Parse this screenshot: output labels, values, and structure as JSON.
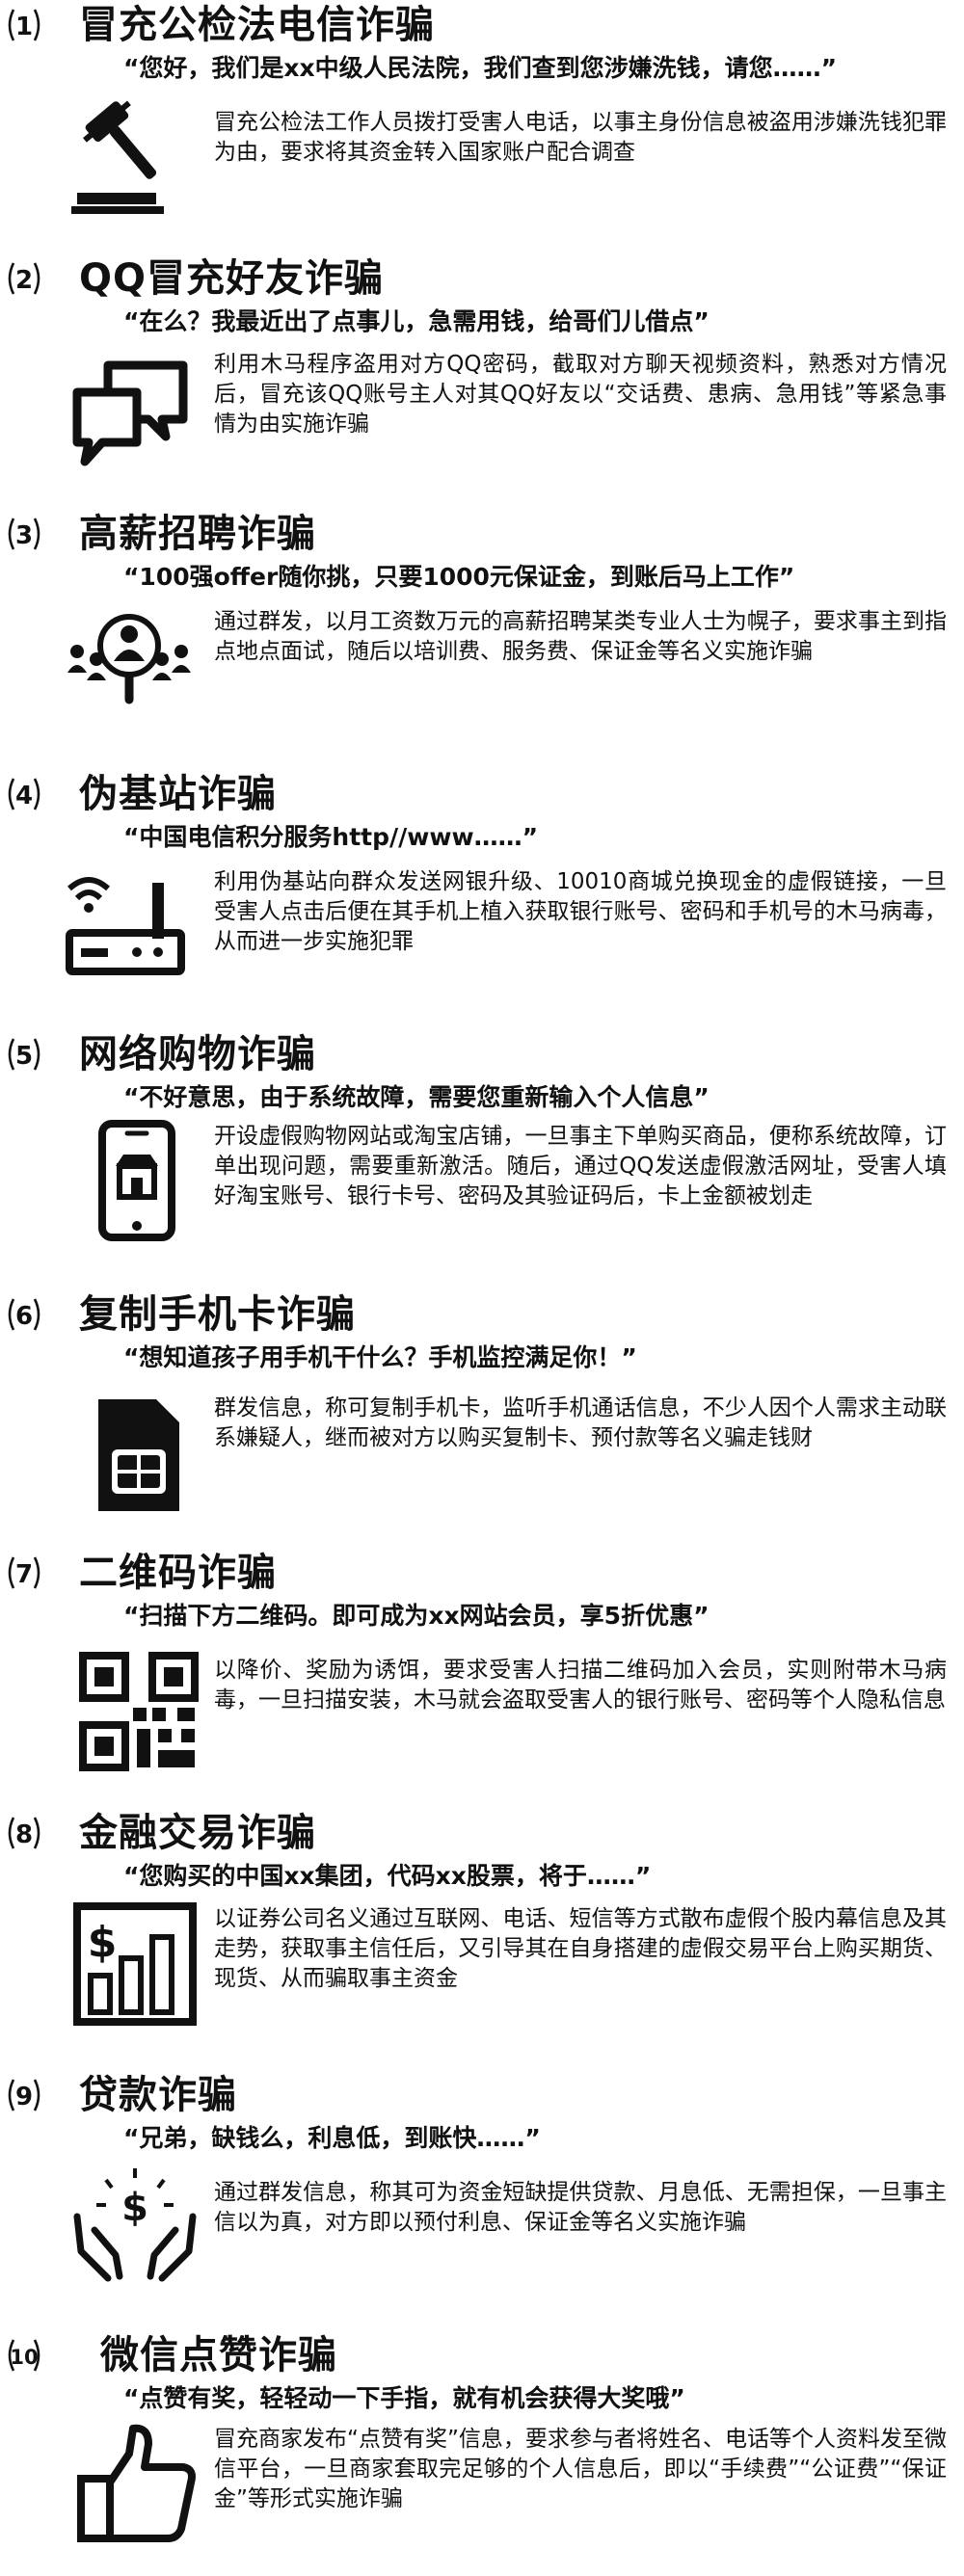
{
  "sections": [
    {
      "number": "1",
      "title": "冒充公检法电信诈骗",
      "quote": "“您好，我们是xx中级人民法院，我们查到您涉嫌洗钱，请您……”",
      "description": "冒充公检法工作人员拨打受害人电话，以事主身份信息被盗用涉嫌洗钱犯罪为由，要求将其资金转入国家账户配合调查",
      "icon": "gavel-icon"
    },
    {
      "number": "2",
      "title": "QQ冒充好友诈骗",
      "quote": "“在么？我最近出了点事儿，急需用钱，给哥们儿借点”",
      "description": "利用木马程序盗用对方QQ密码，截取对方聊天视频资料，熟悉对方情况后，冒充该QQ账号主人对其QQ好友以“交话费、患病、急用钱”等紧急事情为由实施诈骗",
      "icon": "chat-bubbles-icon"
    },
    {
      "number": "3",
      "title": "高薪招聘诈骗",
      "quote": "“100强offer随你挑，只要1000元保证金，到账后马上工作”",
      "description": "通过群发，以月工资数万元的高薪招聘某类专业人士为幌子，要求事主到指点地点面试，随后以培训费、服务费、保证金等名义实施诈骗",
      "icon": "recruit-search-icon"
    },
    {
      "number": "4",
      "title": "伪基站诈骗",
      "quote": "“中国电信积分服务http//www……”",
      "description": "利用伪基站向群众发送网银升级、10010商城兑换现金的虚假链接，一旦受害人点击后便在其手机上植入获取银行账号、密码和手机号的木马病毒，从而进一步实施犯罪",
      "icon": "router-icon"
    },
    {
      "number": "5",
      "title": "网络购物诈骗",
      "quote": "“不好意思，由于系统故障，需要您重新输入个人信息”",
      "description": "开设虚假购物网站或淘宝店铺，一旦事主下单购买商品，便称系统故障，订单出现问题，需要重新激活。随后，通过QQ发送虚假激活网址，受害人填好淘宝账号、银行卡号、密码及其验证码后，卡上金额被划走",
      "icon": "phone-shop-icon"
    },
    {
      "number": "6",
      "title": "复制手机卡诈骗",
      "quote": "“想知道孩子用手机干什么？手机监控满足你！”",
      "description": "群发信息，称可复制手机卡，监听手机通话信息，不少人因个人需求主动联系嫌疑人，继而被对方以购买复制卡、预付款等名义骗走钱财",
      "icon": "sim-card-icon"
    },
    {
      "number": "7",
      "title": "二维码诈骗",
      "quote": "“扫描下方二维码。即可成为xx网站会员，享5折优惠”",
      "description": "以降价、奖励为诱饵，要求受害人扫描二维码加入会员，实则附带木马病毒，一旦扫描安装，木马就会盗取受害人的银行账号、密码等个人隐私信息",
      "icon": "qr-code-icon"
    },
    {
      "number": "8",
      "title": "金融交易诈骗",
      "quote": "“您购买的中国xx集团，代码xx股票，将于……”",
      "description": "以证券公司名义通过互联网、电话、短信等方式散布虚假个股内幕信息及其走势，获取事主信任后，又引导其在自身搭建的虚假交易平台上购买期货、现货、从而骗取事主资金",
      "icon": "stock-chart-icon"
    },
    {
      "number": "9",
      "title": "贷款诈骗",
      "quote": "“兄弟，缺钱么，利息低，到账快……”",
      "description": "通过群发信息，称其可为资金短缺提供贷款、月息低、无需担保，一旦事主信以为真，对方即以预付利息、保证金等名义实施诈骗",
      "icon": "money-hands-icon"
    },
    {
      "number": "10",
      "title": "微信点赞诈骗",
      "quote": "“点赞有奖，轻轻动一下手指，就有机会获得大奖哦”",
      "description": "冒充商家发布“点赞有奖”信息，要求参与者将姓名、电话等个人资料发至微信平台，一旦商家套取完足够的个人信息后，即以“手续费”“公证费”“保证金”等形式实施诈骗",
      "icon": "thumbs-up-icon"
    }
  ]
}
